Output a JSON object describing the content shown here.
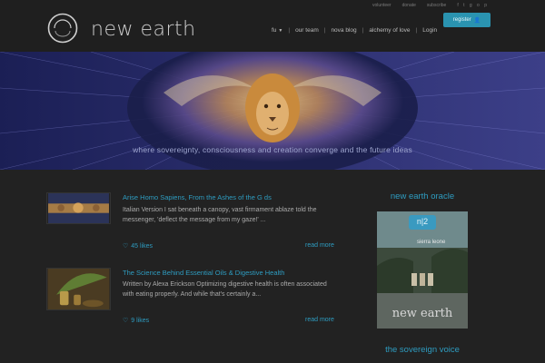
{
  "header": {
    "brand": "new earth",
    "top_links": [
      "volunteer",
      "donate",
      "subscribe"
    ],
    "nav": {
      "language": "fu",
      "items": [
        "our team",
        "nova blog",
        "alchemy of love",
        "Login"
      ]
    },
    "register_label": "register"
  },
  "banner": {
    "tagline": "where sovereignty, consciousness and creation converge and the future ideas"
  },
  "posts": [
    {
      "title": "Arise Homo Sapiens, From the Ashes of the G ds",
      "excerpt": "Italian Version I sat beneath a canopy, vast firmament ablaze told the messenger, 'deflect the message from my gaze!' ...",
      "likes": "45 likes",
      "read_more": "read more"
    },
    {
      "title": "The Science Behind Essential Oils & Digestive Health",
      "excerpt": "Written by Alexa Erickson Optimizing digestive health is often associated with eating properly. And while that's certainly a...",
      "likes": "9 likes",
      "read_more": "read more"
    }
  ],
  "sidebar": {
    "oracle_title": "new earth oracle",
    "magazine_badge": "n|2",
    "magazine_subtitle": "sierra leone",
    "magazine_footer": "new earth",
    "voice_title": "the sovereign voice"
  },
  "colors": {
    "accent": "#2e9cc0",
    "register_bg": "#2a93b0",
    "banner_bg": "#1a1e4a"
  }
}
